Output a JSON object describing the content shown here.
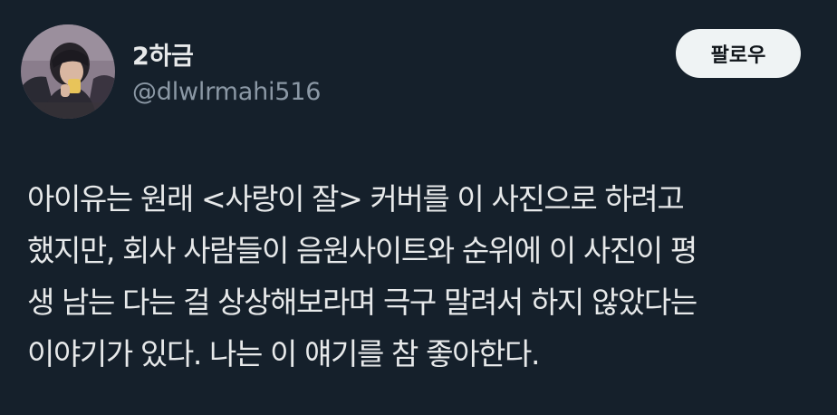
{
  "author": {
    "display_name": "2하금",
    "handle": "@dlwlrmahi516"
  },
  "follow_button": {
    "label": "팔로우"
  },
  "tweet": {
    "lines": [
      "아이유는 원래 <사랑이 잘> 커버를 이 사진으로 하려고",
      "했지만, 회사 사람들이 음원사이트와 순위에 이 사진이 평",
      "생 남는 다는 걸 상상해보라며 극구 말려서 하지 않았다는",
      "이야기가 있다. 나는 이 얘기를 참 좋아한다."
    ]
  },
  "colors": {
    "background": "#15202b",
    "text_primary": "#e7e9ea",
    "text_secondary": "#8b98a5",
    "follow_bg": "#eff3f4",
    "follow_text": "#0f1419"
  }
}
